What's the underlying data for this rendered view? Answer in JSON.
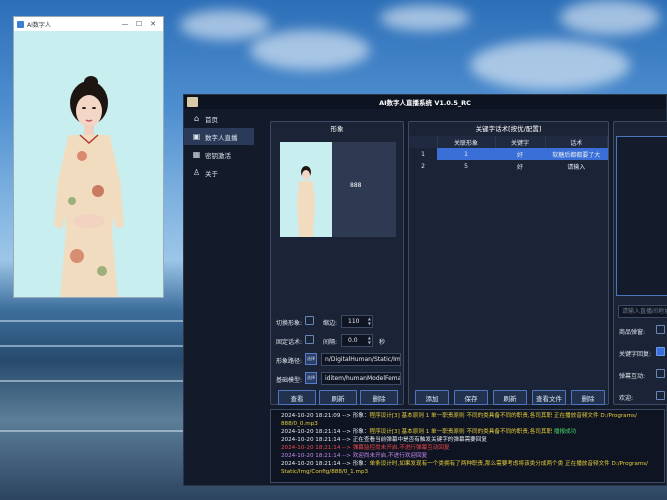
{
  "avatar_window": {
    "title": "AI数字人",
    "controls": {
      "minimize": "—",
      "maximize": "☐",
      "close": "✕"
    }
  },
  "main_window": {
    "title": "AI数字人直播系统 V1.0.5_RC"
  },
  "sidebar": {
    "items": [
      {
        "label": "首页",
        "icon": "home-icon",
        "active": false
      },
      {
        "label": "数字人直播",
        "icon": "live-icon",
        "active": true
      },
      {
        "label": "密钥激活",
        "icon": "key-icon",
        "active": false
      },
      {
        "label": "关于",
        "icon": "person-icon",
        "active": false
      }
    ]
  },
  "image_panel": {
    "title": "形象",
    "preview_label": "888",
    "switch_label": "切换形象:",
    "switch_checked": false,
    "margin_label": "缩边:",
    "margin_value": "110",
    "fixed_script_label": "固定话术:",
    "fixed_script_checked": false,
    "interval_label": "间隔:",
    "interval_value": "0.0",
    "interval_unit": "秒",
    "path_label": "形象路径:",
    "path_button": "选择",
    "path_value": "n/DigitalHuman/Static/Img",
    "model_label": "基础模型:",
    "model_button": "选择",
    "model_value": "iditem/humanModelFemale",
    "buttons": {
      "view": "查看",
      "refresh": "刷新",
      "delete": "删除"
    }
  },
  "keyword_panel": {
    "title": "关键字话术[按优/配置]",
    "columns": [
      "",
      "关联形象",
      "关键字",
      "话术"
    ],
    "rows": [
      {
        "index": "1",
        "image": "1",
        "keyword": "好",
        "script": "软糖后都都要了大"
      },
      {
        "index": "2",
        "image": "5",
        "keyword": "好",
        "script": "请输入"
      }
    ],
    "buttons": {
      "add": "添加",
      "save": "保存",
      "refresh": "刷新",
      "view_file": "查看文件",
      "delete": "删除"
    }
  },
  "right_panel": {
    "placeholder": "请输入直播间地址",
    "options": [
      {
        "label": "商品弹窗:",
        "checked": false
      },
      {
        "label": "关键字回复:",
        "checked": true
      },
      {
        "label": "弹幕互动:",
        "checked": false
      },
      {
        "label": "欢迎:",
        "checked": false
      }
    ]
  },
  "log": {
    "lines": [
      {
        "time": "2024-10-20 18:21:09",
        "parts": [
          {
            "t": " --> 形象：",
            "c": "white"
          },
          {
            "t": "程序设计[3] 基本原则 1 单一职责原则 不同的类具备不同的职责,各司其职 正在播放音频文件 D:/Programs/",
            "c": "yellow"
          }
        ]
      },
      {
        "time": "",
        "parts": [
          {
            "t": "888/0_0.mp3",
            "c": "yellow"
          }
        ]
      },
      {
        "time": "2024-10-20 18:21:14",
        "parts": [
          {
            "t": " --> 形象：",
            "c": "white"
          },
          {
            "t": "程序设计[3] 基本原则 1 单一职责原则 不同的类具备不同的职责,各司其职",
            "c": "yellow"
          },
          {
            "t": " 播报成功",
            "c": "green"
          }
        ]
      },
      {
        "time": "2024-10-20 18:21:14",
        "parts": [
          {
            "t": " --> 正在查看当前弹幕中是否有触发关键字的弹幕需要回复",
            "c": "white"
          }
        ]
      },
      {
        "time": "2024-10-20 18:21:14",
        "parts": [
          {
            "t": " --> 弹幕监控尚未开启,不进行弹幕互动回复",
            "c": "red"
          }
        ]
      },
      {
        "time": "2024-10-20 18:21:14",
        "parts": [
          {
            "t": " --> 欢迎尚未开启,不进行欢迎回复",
            "c": "purple"
          }
        ]
      },
      {
        "time": "2024-10-20 18:21:14",
        "parts": [
          {
            "t": " --> 形象：",
            "c": "white"
          },
          {
            "t": "单条设计时,如果发现有一个类拥有了两种职责,那么需要考虑将该类分成两个类 正在播放音频文件 D:/Programs/",
            "c": "yellow"
          }
        ]
      },
      {
        "time": "",
        "parts": [
          {
            "t": "Static/Img/Config/888/0_1.mp3",
            "c": "yellow"
          }
        ]
      }
    ]
  }
}
